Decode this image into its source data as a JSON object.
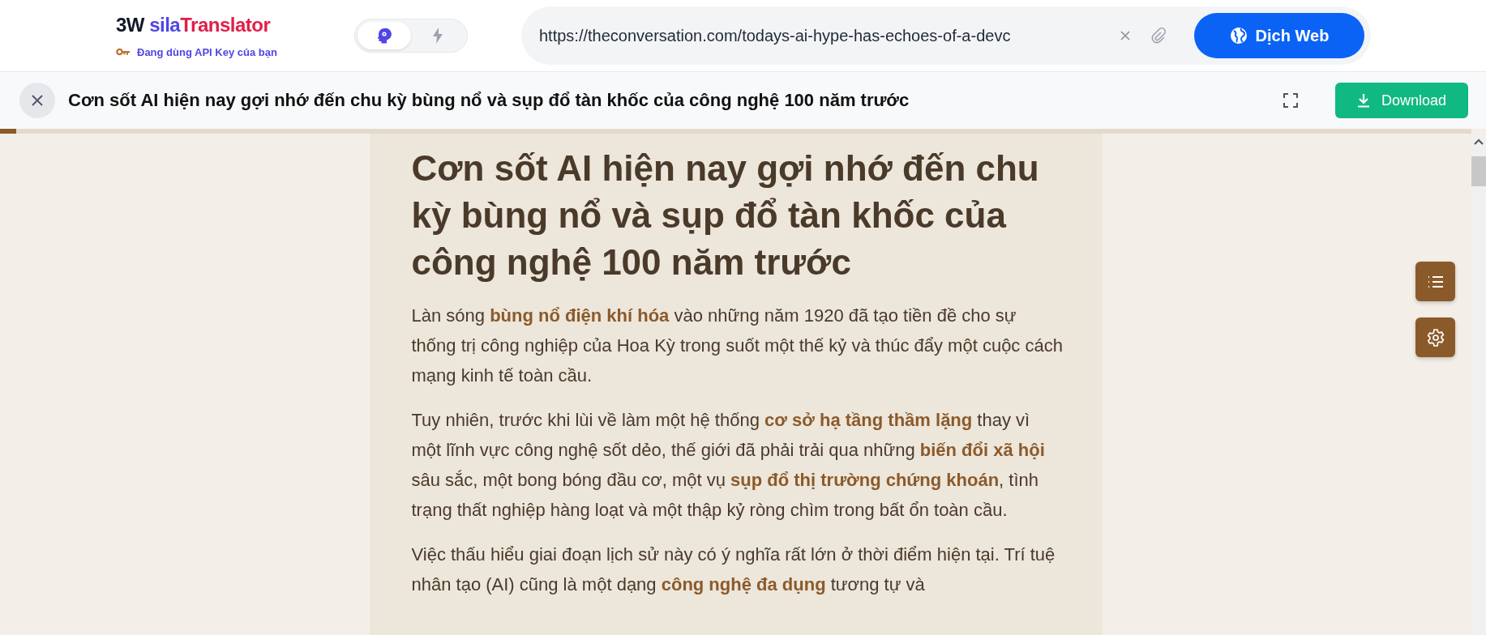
{
  "header": {
    "logo": {
      "part_1": "3W",
      "part_2": "sila",
      "part_3": "Translator"
    },
    "api_status": "Đang dùng API Key của bạn",
    "modes": [
      {
        "kind": "ai",
        "selected": true
      },
      {
        "kind": "fast",
        "selected": false
      }
    ],
    "url_field": {
      "value": "https://theconversation.com/todays-ai-hype-has-echoes-of-a-devc"
    },
    "translate_button": "Dịch Web"
  },
  "title_bar": {
    "title": "Cơn sốt AI hiện nay gợi nhớ đến chu kỳ bùng nổ và sụp đổ tàn khốc của công nghệ 100 năm trước",
    "download_button": "Download"
  },
  "reading_progress": {
    "level": 0.011
  },
  "article": {
    "heading": "Cơn sốt AI hiện nay gợi nhớ đến chu kỳ bùng nổ và sụp đổ tàn khốc của công nghệ 100 năm trước",
    "paragraphs": [
      "Làn sóng **bùng nổ điện khí hóa** vào những năm 1920 đã tạo tiền đề cho sự thống trị công nghiệp của Hoa Kỳ trong suốt một thế kỷ và thúc đẩy một cuộc cách mạng kinh tế toàn cầu.",
      "Tuy nhiên, trước khi lùi về làm một hệ thống **cơ sở hạ tầng thầm lặng** thay vì một lĩnh vực công nghệ sốt dẻo, thế giới đã phải trải qua những **biến đổi xã hội** sâu sắc, một bong bóng đầu cơ, một vụ **sụp đổ thị trường chứng khoán**, tình trạng thất nghiệp hàng loạt và một thập kỷ ròng chìm trong bất ổn toàn cầu.",
      "Việc thấu hiểu giai đoạn lịch sử này có ý nghĩa rất lớn ở thời điểm hiện tại. Trí tuệ nhân tạo (AI) cũng là một dạng **công nghệ đa dụng** tương tự và"
    ]
  }
}
